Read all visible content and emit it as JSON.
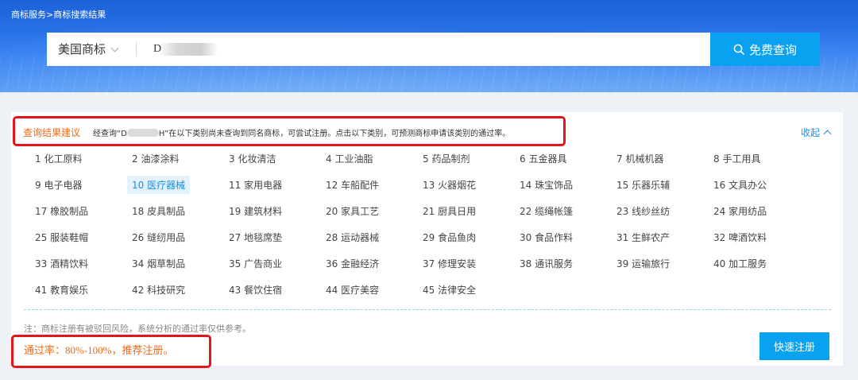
{
  "header": {
    "breadcrumb": "商标服务>商标搜索结果",
    "search": {
      "type_label": "美国商标",
      "query": "D",
      "button_label": "免费查询"
    }
  },
  "suggestion": {
    "title": "查询结果建议",
    "text_before": "经查询“D",
    "text_after": "H”在以下类别尚未查询到同名商标，可尝试注册。点击以下类别，可预测商标申请该类别的通过率。",
    "collapse_label": "收起"
  },
  "categories": [
    "1 化工原料",
    "2 油漆涂料",
    "3 化妆清洁",
    "4 工业油脂",
    "5 药品制剂",
    "6 五金器具",
    "7 机械机器",
    "8 手工用具",
    "9 电子电器",
    "10 医疗器械",
    "11 家用电器",
    "12 车船配件",
    "13 火器烟花",
    "14 珠宝饰品",
    "15 乐器乐辅",
    "16 文具办公",
    "17 橡胶制品",
    "18 皮具制品",
    "19 建筑材料",
    "20 家具工艺",
    "21 厨具日用",
    "22 缆绳帐篷",
    "23 线纱丝纺",
    "24 家用纺品",
    "25 服装鞋帽",
    "26 缝纫用品",
    "27 地毯席垫",
    "28 运动器械",
    "29 食品鱼肉",
    "30 食品作料",
    "31 生鲜农产",
    "32 啤酒饮料",
    "33 酒精饮料",
    "34 烟草制品",
    "35 广告商业",
    "36 金融经济",
    "37 修理安装",
    "38 通讯服务",
    "39 运输旅行",
    "40 加工服务",
    "41 教育娱乐",
    "42 科技研究",
    "43 餐饮住宿",
    "44 医疗美容",
    "45 法律安全"
  ],
  "selected_category": "10 医疗器械",
  "footer": {
    "note": "注：商标注册有被驳回风险，系统分析的通过率仅供参考。",
    "pass_rate": "通过率：80%-100%，推荐注册。",
    "quick_register_label": "快速注册"
  },
  "colors": {
    "accent_blue": "#0aa2f0",
    "highlight_orange": "#f06a14",
    "annotation_red": "#e5151c"
  }
}
